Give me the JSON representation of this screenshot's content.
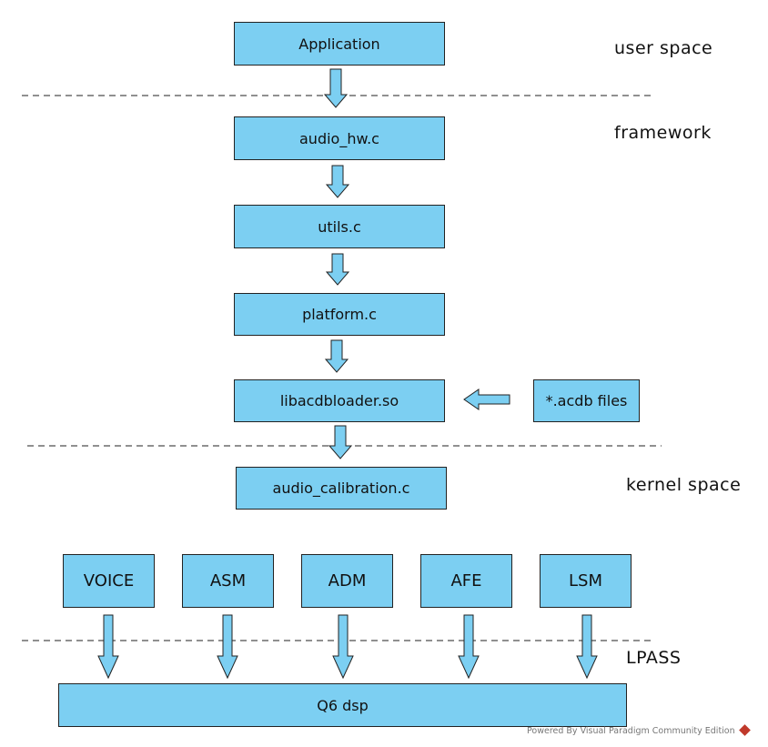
{
  "colors": {
    "box_fill": "#7ccff2",
    "stroke": "#222222"
  },
  "boxes": {
    "application": "Application",
    "audio_hw": "audio_hw.c",
    "utils": "utils.c",
    "platform": "platform.c",
    "libacdbloader": "libacdbloader.so",
    "acdb_files": "*.acdb files",
    "audio_calibration": "audio_calibration.c",
    "voice": "VOICE",
    "asm": "ASM",
    "adm": "ADM",
    "afe": "AFE",
    "lsm": "LSM",
    "q6dsp": "Q6 dsp"
  },
  "layers": {
    "user_space": "user space",
    "framework": "framework",
    "kernel_space": "kernel space",
    "lpass": "LPASS"
  },
  "watermark": "Powered By Visual Paradigm Community Edition"
}
